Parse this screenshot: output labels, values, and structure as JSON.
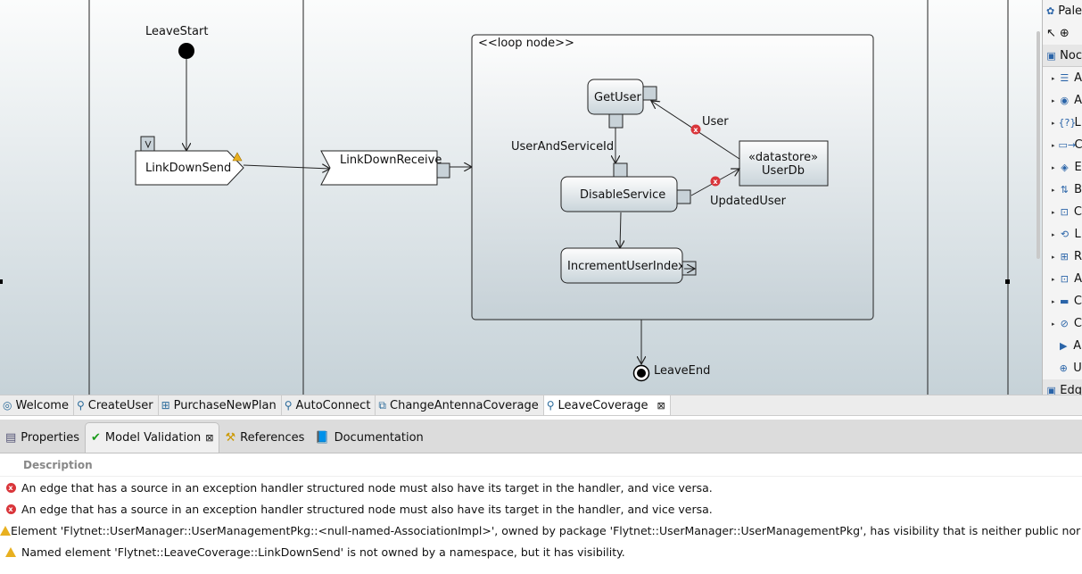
{
  "diagram": {
    "nodes": {
      "leave_start": "LeaveStart",
      "link_down_send": "LinkDownSend",
      "link_down_receive": "LinkDownReceive",
      "loop_node": "<<loop node>>",
      "get_user": "GetUser",
      "disable_service": "DisableService",
      "increment_user_index": "IncrementUserIndex",
      "datastore_stereotype": "«datastore»",
      "user_db": "UserDb",
      "leave_end": "LeaveEnd"
    },
    "edges": {
      "user": "User",
      "user_and_service_id": "UserAndServiceId",
      "updated_user": "UpdatedUser"
    }
  },
  "palette": {
    "title": "Pale",
    "nodes_group": "Noc",
    "items": [
      "A",
      "A",
      "L",
      "C",
      "E",
      "B",
      "C",
      "L",
      "R",
      "A",
      "C",
      "C",
      "A",
      "U"
    ],
    "edges_group": "Edg"
  },
  "editor_tabs": [
    {
      "label": "Welcome",
      "icon": "welcome-icon"
    },
    {
      "label": "CreateUser",
      "icon": "activity-diagram-icon"
    },
    {
      "label": "PurchaseNewPlan",
      "icon": "state-diagram-icon"
    },
    {
      "label": "AutoConnect",
      "icon": "activity-diagram-icon"
    },
    {
      "label": "ChangeAntennaCoverage",
      "icon": "sequence-diagram-icon"
    },
    {
      "label": "LeaveCoverage",
      "icon": "activity-diagram-icon",
      "active": true
    }
  ],
  "view_tabs": [
    {
      "label": "Properties"
    },
    {
      "label": "Model Validation",
      "active": true
    },
    {
      "label": "References"
    },
    {
      "label": "Documentation"
    }
  ],
  "validation": {
    "column": "Description",
    "rows": [
      {
        "severity": "error",
        "text": "An edge that has a source in an exception handler structured node must also have its target in the handler, and vice versa."
      },
      {
        "severity": "error",
        "text": "An edge that has a source in an exception handler structured node must also have its target in the handler, and vice versa."
      },
      {
        "severity": "warning",
        "text": "Element 'Flytnet::UserManager::UserManagementPkg::<null-named-AssociationImpl>', owned by package 'Flytnet::UserManager::UserManagementPkg', has visibility that is neither public nor private."
      },
      {
        "severity": "warning",
        "text": "Named element 'Flytnet::LeaveCoverage::LinkDownSend' is not owned by a namespace, but it has visibility."
      }
    ]
  },
  "colors": {
    "error": "#d9353a",
    "warning": "#e8b020",
    "node_fill": "#dfe6ea"
  }
}
